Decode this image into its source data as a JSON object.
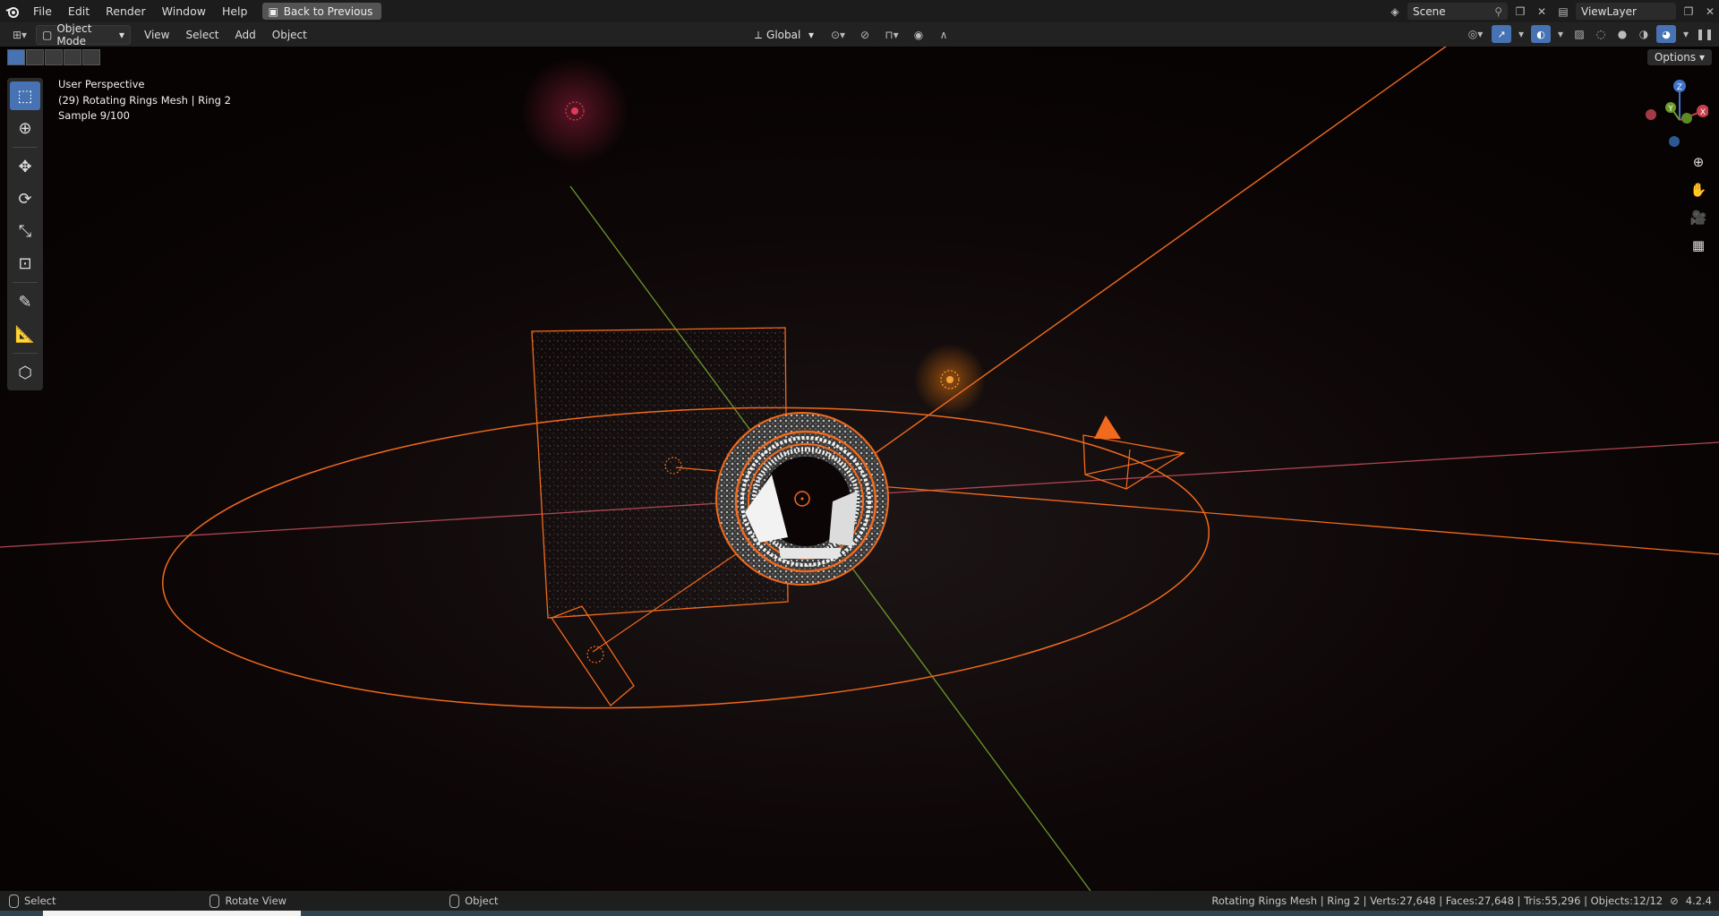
{
  "menu": {
    "file": "File",
    "edit": "Edit",
    "render": "Render",
    "window": "Window",
    "help": "Help",
    "back": "Back to Previous"
  },
  "top_right": {
    "scene": "Scene",
    "view_layer": "ViewLayer"
  },
  "header": {
    "mode": "Object Mode",
    "view": "View",
    "select": "Select",
    "add": "Add",
    "object": "Object",
    "transform_orientation": "Global",
    "options": "Options"
  },
  "overlay": {
    "perspective": "User Perspective",
    "object_info": "(29) Rotating Rings Mesh | Ring 2",
    "sample": "Sample 9/100"
  },
  "gizmo": {
    "x": "X",
    "y": "Y",
    "z": "Z"
  },
  "status": {
    "select": "Select",
    "rotate": "Rotate View",
    "object": "Object",
    "stats": "Rotating Rings Mesh | Ring 2 | Verts:27,648 | Faces:27,648 | Tris:55,296 | Objects:12/12",
    "version": "4.2.4"
  },
  "colors": {
    "selection_orange": "#f26a1d",
    "axis_red": "#c8414c",
    "axis_green": "#6a9a2a",
    "active_blue": "#4772b3"
  }
}
